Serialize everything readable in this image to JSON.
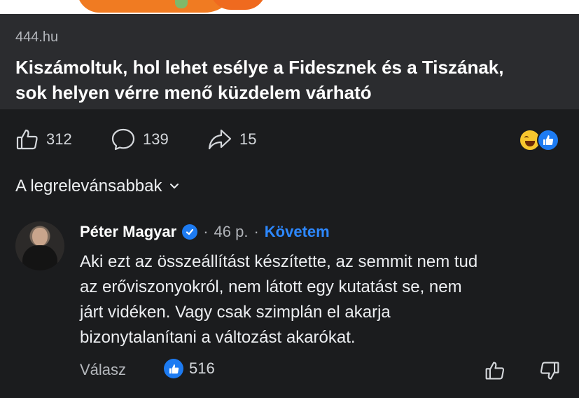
{
  "link": {
    "domain": "444.hu",
    "title_line1": "Kiszámoltuk, hol lehet esélye a Fidesznek és a Tiszának,",
    "title_line2": "sok helyen vérre menő küzdelem várható"
  },
  "actions": {
    "likes": "312",
    "comments": "139",
    "shares": "15"
  },
  "reactions": [
    "haha-icon",
    "like-icon"
  ],
  "sort": {
    "label": "A legrelevánsabbak"
  },
  "comment": {
    "author": "Péter Magyar",
    "separator": "·",
    "time": "46 p.",
    "follow": "Követem",
    "text": [
      "Aki ezt az összeállítást készítette, az semmit nem tud",
      "az erőviszonyokról, nem látott egy kutatást se, nem",
      "járt vidéken. Vagy csak szimplán el akarja",
      "bizonytalanítani a változást akarókat."
    ],
    "reply_label": "Válasz",
    "like_count": "516"
  },
  "colors": {
    "background": "#1b1c1e",
    "card": "#2b2c2f",
    "accent": "#2d88ff",
    "like_blue": "#1d7bf2"
  }
}
